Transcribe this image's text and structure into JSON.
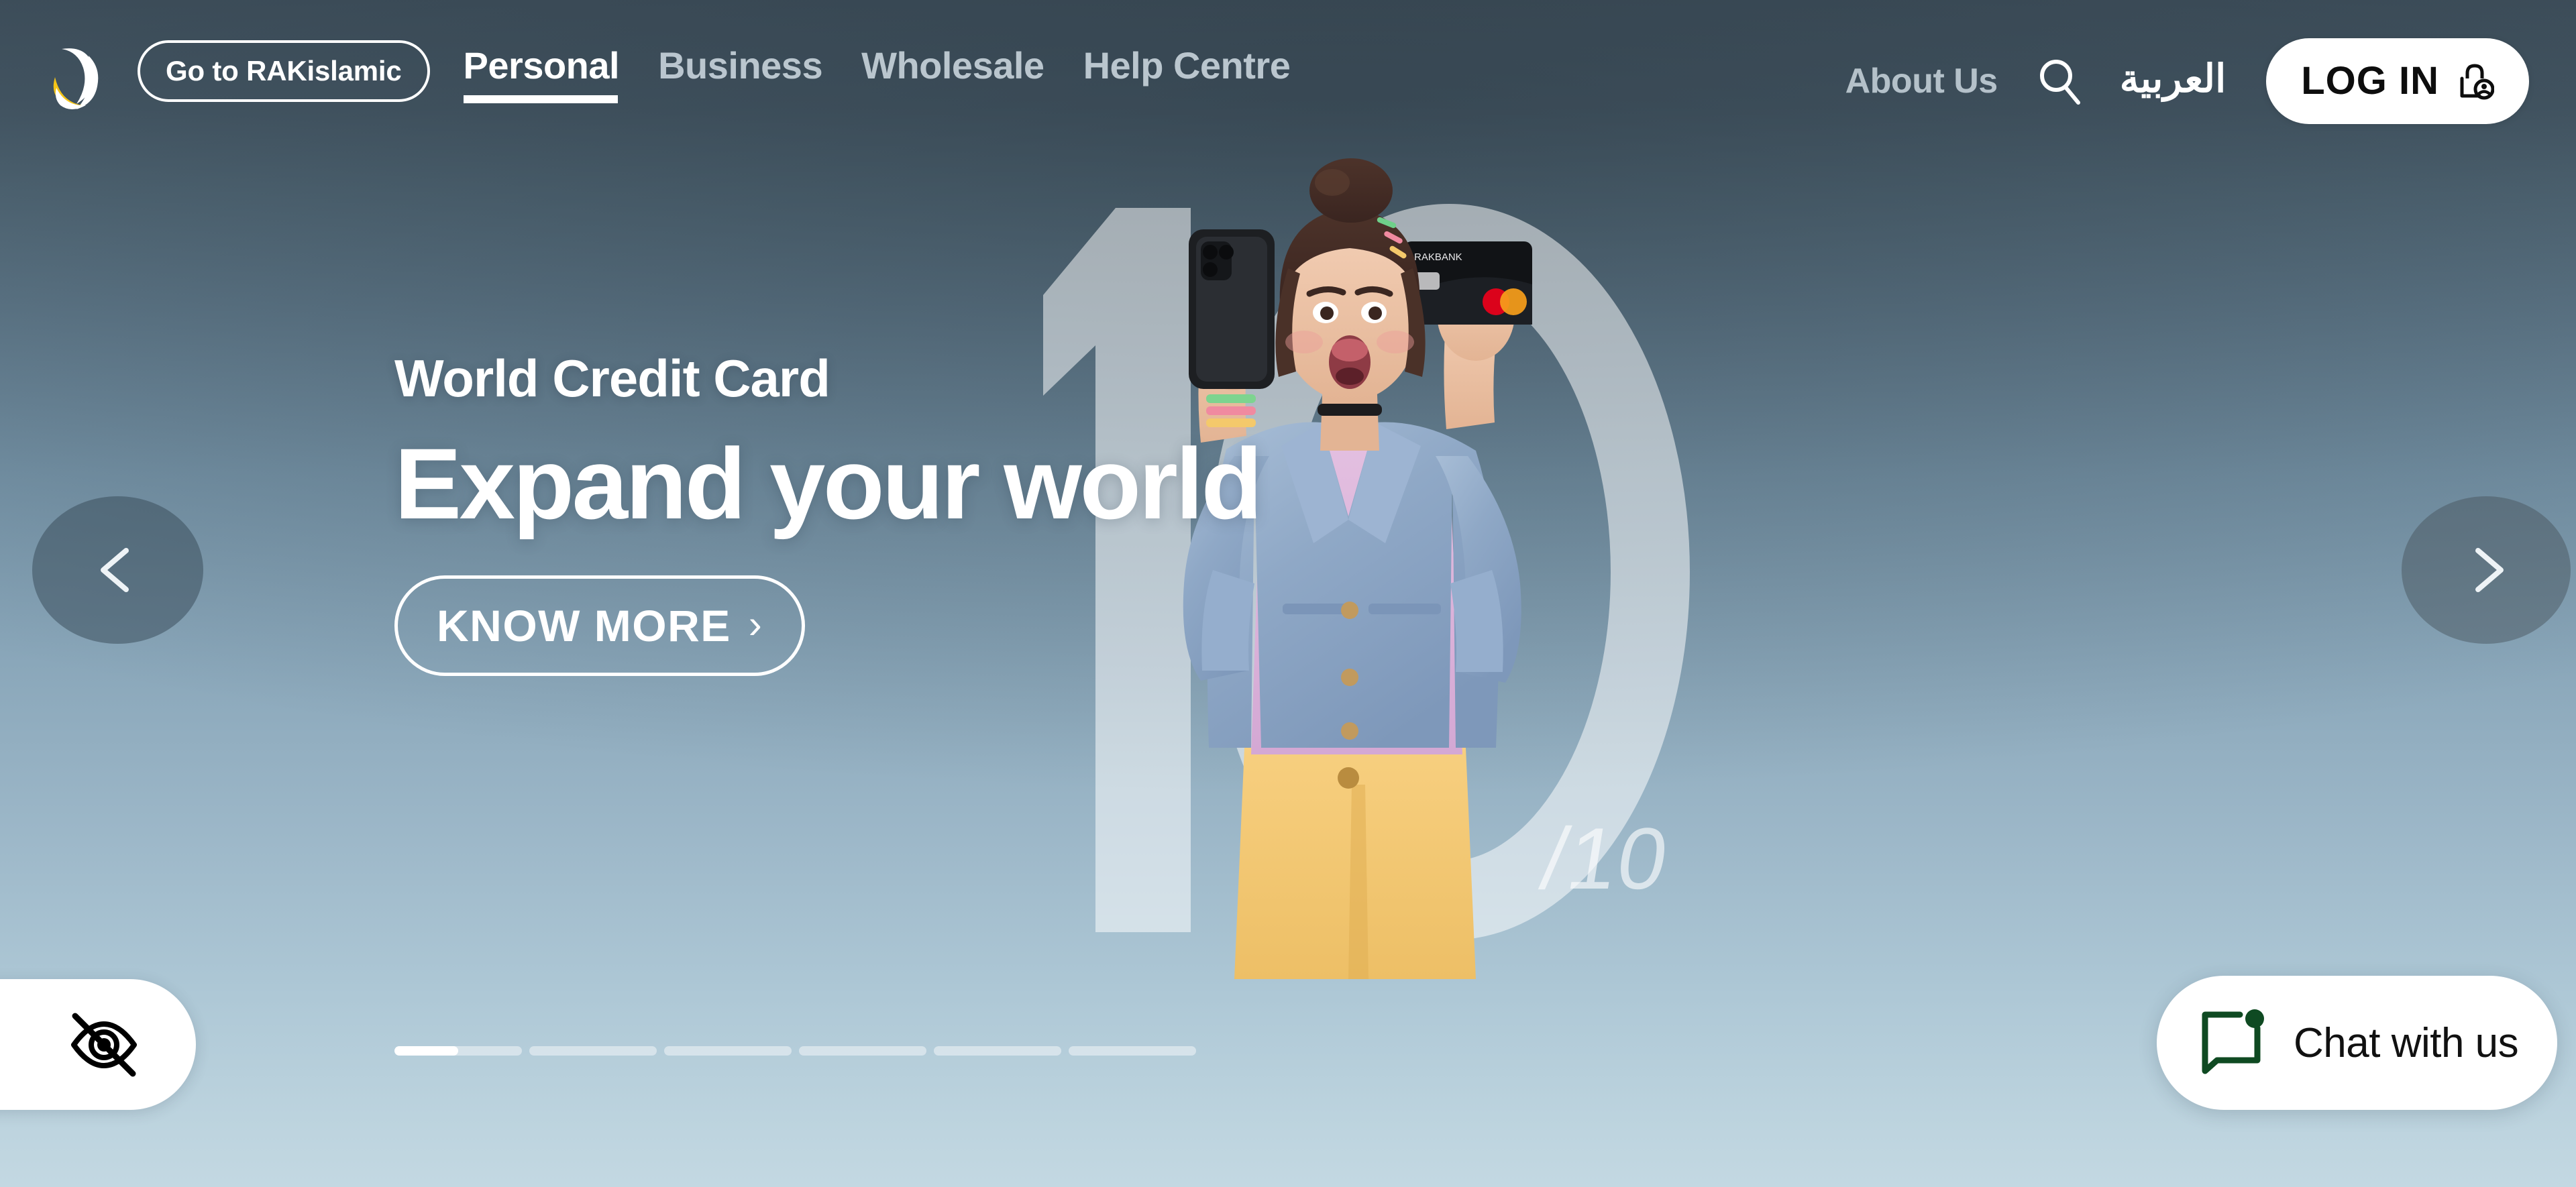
{
  "header": {
    "logo_name": "rakbank-logo",
    "islamic_button": "Go to RAKislamic",
    "nav": [
      {
        "label": "Personal",
        "active": true
      },
      {
        "label": "Business",
        "active": false
      },
      {
        "label": "Wholesale",
        "active": false
      },
      {
        "label": "Help Centre",
        "active": false
      }
    ],
    "about_us": "About Us",
    "search_icon": "search-icon",
    "arabic_label": "العربية",
    "login_label": "LOG IN",
    "login_icon": "lock-user-icon"
  },
  "hero": {
    "eyebrow": "World Credit Card",
    "title": "Expand your world",
    "cta_label": "KNOW MORE",
    "cta_chevron": "›",
    "background_number": "10",
    "rating_mark": "/10",
    "prev_icon": "chevron-left-icon",
    "next_icon": "chevron-right-icon"
  },
  "carousel": {
    "total_slides": 6,
    "current_slide": 1,
    "progress_percent": 50,
    "indicators": [
      {
        "index": 1,
        "active": true,
        "fill": 50
      },
      {
        "index": 2,
        "active": false,
        "fill": 0
      },
      {
        "index": 3,
        "active": false,
        "fill": 0
      },
      {
        "index": 4,
        "active": false,
        "fill": 0
      },
      {
        "index": 5,
        "active": false,
        "fill": 0
      },
      {
        "index": 6,
        "active": false,
        "fill": 0
      }
    ]
  },
  "accessibility": {
    "icon": "eye-off-icon"
  },
  "chat": {
    "label": "Chat with us",
    "icon": "chat-bubble-icon",
    "icon_color": "#0f4a22"
  },
  "colors": {
    "gradient_top": "#41525f",
    "gradient_bottom": "#c3d8e2",
    "accent_white": "#ffffff",
    "logo_gold": "#f5c518",
    "chat_green": "#0f4a22"
  }
}
